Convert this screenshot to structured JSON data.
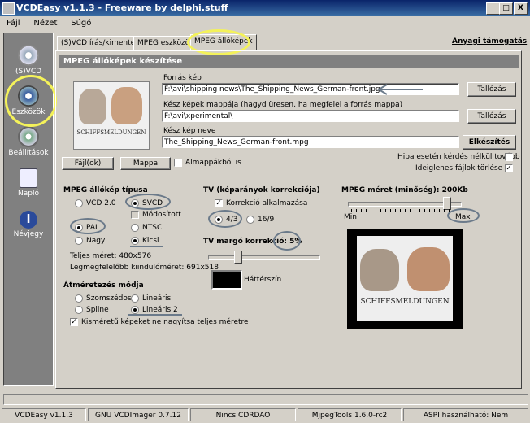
{
  "window": {
    "title": "VCDEasy v1.1.3 - Freeware by delphi.stuff",
    "min": "_",
    "max": "□",
    "close": "X"
  },
  "menu": [
    "Fájl",
    "Nézet",
    "Súgó"
  ],
  "sidebar": [
    {
      "label": "(S)VCD",
      "icon": "vcd-disc-icon"
    },
    {
      "label": "Eszközök",
      "icon": "tools-disc-icon"
    },
    {
      "label": "Beállítások",
      "icon": "settings-icon"
    },
    {
      "label": "Napló",
      "icon": "log-icon"
    },
    {
      "label": "Névjegy",
      "icon": "info-icon"
    }
  ],
  "tabs": [
    "(S)VCD írás/kimentés",
    "MPEG eszközök",
    "MPEG állóképek"
  ],
  "support_link": "Anyagi támogatás",
  "section_title": "MPEG állóképek készítése",
  "source": {
    "label": "Forrás kép",
    "value": "F:\\avi\\shipping news\\The_Shipping_News_German-front.jpg",
    "button": "Tallózás"
  },
  "folder": {
    "label": "Kész képek mappája (hagyd üresen, ha megfelel a forrás mappa)",
    "value": "F:\\avi\\xperimental\\",
    "button": "Tallózás"
  },
  "output": {
    "label": "Kész kép neve",
    "value": "The_Shipping_News_German-front.mpg",
    "button": "Elkészítés"
  },
  "options": {
    "no_ask": "Hiba esetén kérdés nélkül tovább",
    "delete_temp": "Ideiglenes fájlok törlése",
    "subfolders": "Almappákból is"
  },
  "file_buttons": {
    "files": "Fájl(ok)",
    "folder": "Mappa"
  },
  "mpeg_type": {
    "title": "MPEG állókép típusa",
    "vcd": "VCD 2.0",
    "svcd": "SVCD",
    "modified": "Módosított",
    "pal": "PAL",
    "ntsc": "NTSC",
    "big": "Nagy",
    "small": "Kicsi",
    "full_size": "Teljes méret: 480x576",
    "best_size": "Legmegfelelőbb kiindulóméret: 691x518"
  },
  "resize": {
    "title": "Átméretezés módja",
    "neighbor": "Szomszédos l",
    "linear": "Lineáris",
    "spline": "Spline",
    "linear2": "Lineáris 2",
    "no_enlarge": "Kisméretű képeket ne nagyítsa teljes méretre"
  },
  "tv_aspect": {
    "title": "TV (képarányok korrekciója)",
    "apply": "Korrekció alkalmazása",
    "r43": "4/3",
    "r169": "16/9"
  },
  "tv_margin": {
    "title": "TV margó korrekció: 5%",
    "value_pct": 5,
    "bg_label": "Háttérszín"
  },
  "quality": {
    "title": "MPEG méret (minőség): 200Kb",
    "min": "Min",
    "max": "Max",
    "level": 0.9
  },
  "poster_text": "SCHIFFSMELDUNGEN",
  "status": [
    "VCDEasy v1.1.3",
    "GNU VCDImager 0.7.12",
    "Nincs CDRDAO",
    "MjpegTools 1.6.0-rc2",
    "ASPI használható: Nem"
  ],
  "colors": {
    "title_bar": "#0a246a",
    "highlight": "#f4f25a",
    "section": "#808080"
  }
}
